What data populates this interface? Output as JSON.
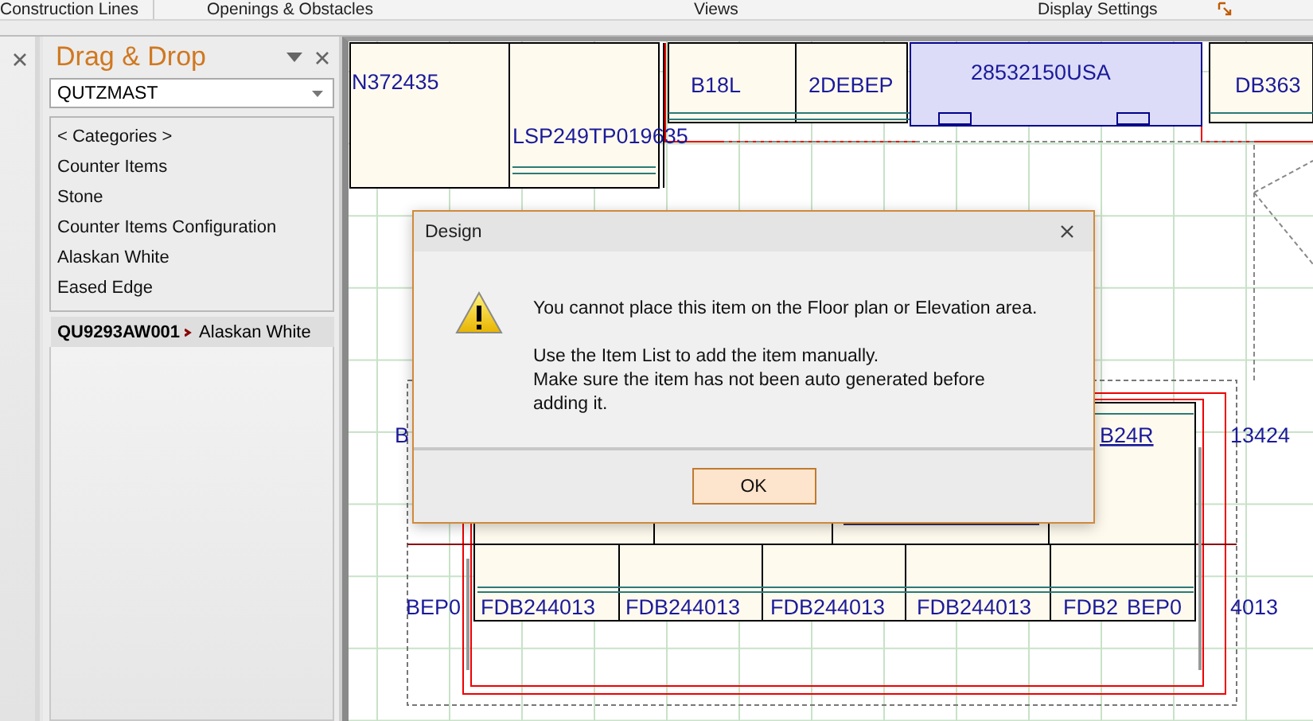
{
  "ribbon_groups": [
    "Construction Lines",
    "Openings & Obstacles",
    "Views",
    "Display Settings"
  ],
  "drag_drop": {
    "title": "Drag & Drop",
    "catalog": "QUTZMAST",
    "categories": [
      {
        "label": "< Categories >"
      },
      {
        "label": "Counter Items"
      },
      {
        "label": "Stone"
      },
      {
        "label": "Counter Items Configuration"
      },
      {
        "label": "Alaskan White"
      },
      {
        "label": "Eased Edge"
      }
    ],
    "selected_item": {
      "code": "QU9293AW001",
      "description": "Alaskan White"
    }
  },
  "canvas_labels": [
    {
      "text": "N372435",
      "underlined": false
    },
    {
      "text": "LSP249TP019635",
      "underlined": false
    },
    {
      "text": "B18L",
      "underlined": false
    },
    {
      "text": "2DEBEP",
      "underlined": false
    },
    {
      "text": "28532150USA",
      "underlined": false
    },
    {
      "text": "DB363",
      "underlined": false
    },
    {
      "text": "B",
      "underlined": false
    },
    {
      "text": "B24R",
      "underlined": true
    },
    {
      "text": "13424",
      "underlined": false
    },
    {
      "text": "BEP0",
      "underlined": false
    },
    {
      "text": "FDB244013",
      "underlined": false
    },
    {
      "text": "FDB244013",
      "underlined": false
    },
    {
      "text": "FDB244013",
      "underlined": false
    },
    {
      "text": "FDB244013",
      "underlined": false
    },
    {
      "text": "FDB2",
      "underlined": false
    },
    {
      "text": "BEP0",
      "underlined": false
    },
    {
      "text": "4013",
      "underlined": false
    }
  ],
  "dialog": {
    "title": "Design",
    "message": [
      [
        "You cannot place this item on the Floor plan or Elevation area."
      ],
      [
        "Use the Item List to add the item manually.",
        "Make sure the item has not been auto generated before",
        "adding it."
      ]
    ],
    "button": "OK"
  }
}
